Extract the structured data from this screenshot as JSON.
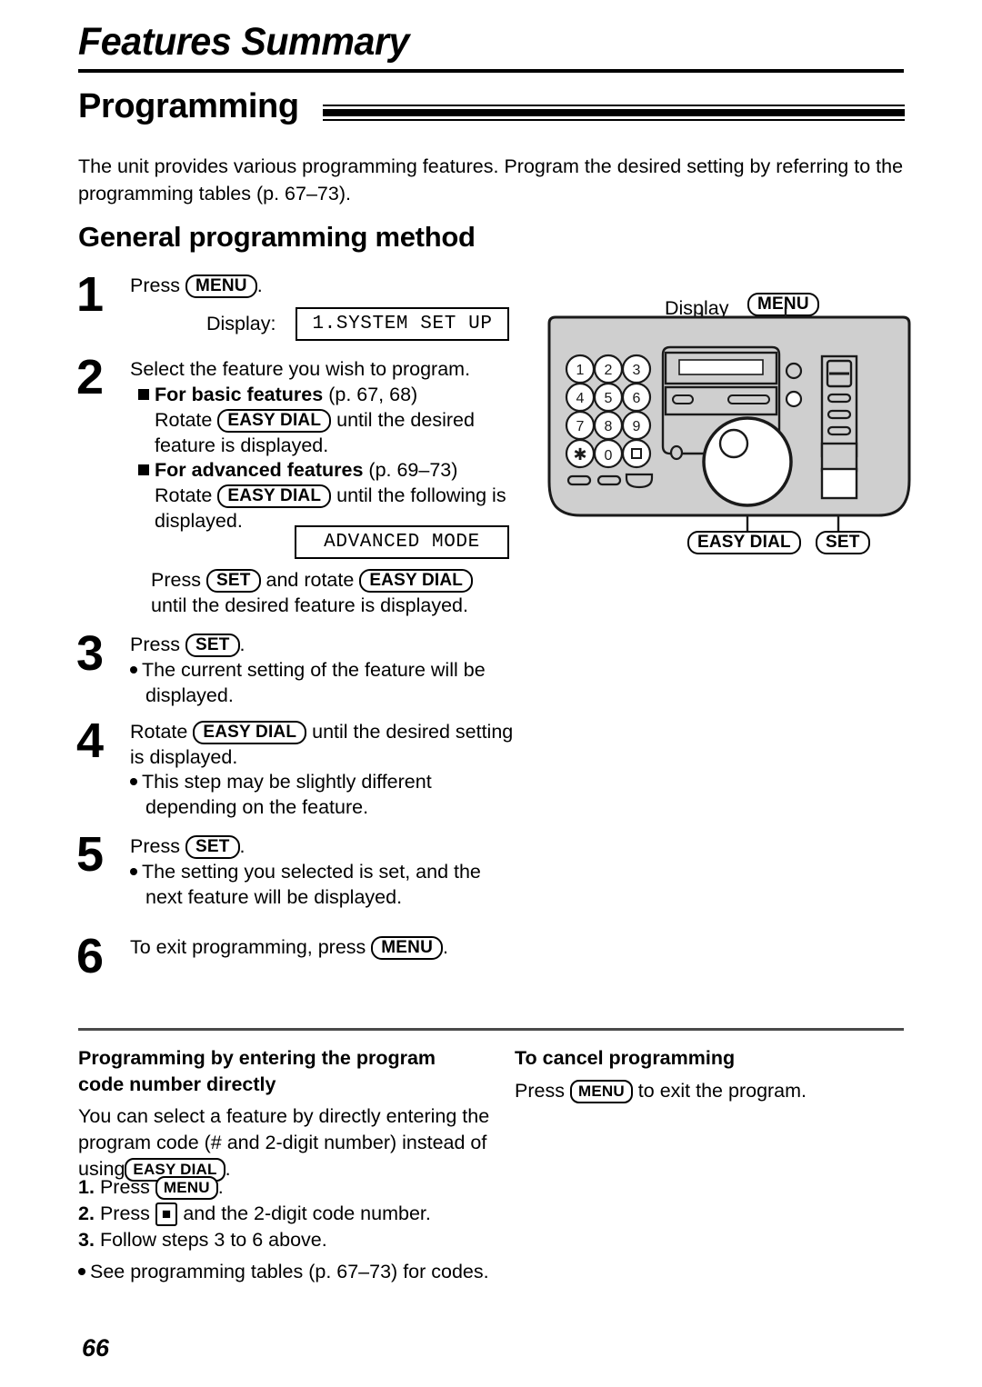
{
  "header": {
    "chapter_title": "Features Summary",
    "section_title": "Programming",
    "intro_line1": "The unit provides various programming features. Program the desired setting by referring to the",
    "intro_line2": "programming tables (p. 67–73).",
    "subsection_title": "General programming method"
  },
  "steps": {
    "s1": {
      "number": "1",
      "press_label": "Press",
      "key_menu": "MENU",
      "period": ".",
      "display_label": "Display:",
      "lcd_text": "1.SYSTEM SET UP"
    },
    "s2": {
      "number": "2",
      "intro": "Select the feature you wish to program.",
      "basic_heading": "For basic features",
      "basic_pages": "(p. 67, 68)",
      "basic_line1_a": "Rotate",
      "basic_key": "EASY DIAL",
      "basic_line1_b": "until the desired",
      "basic_line2": "feature is displayed.",
      "advanced_heading": "For advanced features",
      "advanced_pages": "(p. 69–73)",
      "advanced_line1_a": "Rotate",
      "advanced_key": "EASY DIAL",
      "advanced_line1_b": "until the following is",
      "advanced_line2": "displayed.",
      "lcd_text": "ADVANCED MODE",
      "press_a": "Press",
      "key_set": "SET",
      "press_b": "and rotate",
      "key_easy_dial": "EASY DIAL",
      "press_line2": "until the desired feature is displayed."
    },
    "s3": {
      "number": "3",
      "press_label": "Press",
      "key_set": "SET",
      "period": ".",
      "bullet_line1": "The current setting of the feature will be",
      "bullet_line2": "displayed."
    },
    "s4": {
      "number": "4",
      "line1_a": "Rotate",
      "key_easy_dial": "EASY DIAL",
      "line1_b": "until the desired setting",
      "line2": "is displayed.",
      "bullet_line1": "This step may be slightly different",
      "bullet_line2": "depending on the feature."
    },
    "s5": {
      "number": "5",
      "press_label": "Press",
      "key_set": "SET",
      "period": ".",
      "bullet_line1": "The setting you selected is set, and the",
      "bullet_line2": "next feature will be displayed."
    },
    "s6": {
      "number": "6",
      "text_a": "To exit programming, press",
      "key_menu": "MENU",
      "period": "."
    }
  },
  "device": {
    "label_display": "Display",
    "label_menu": "MENU",
    "label_easy_dial": "EASY DIAL",
    "label_set": "SET",
    "keypad": [
      "1",
      "2",
      "3",
      "4",
      "5",
      "6",
      "7",
      "8",
      "9",
      "✳",
      "0",
      "■"
    ],
    "body_color": "#cfcfcf",
    "outline_color": "#1a1a1a"
  },
  "bottom": {
    "left": {
      "heading_line1": "Programming by entering the program",
      "heading_line2": "code number directly",
      "body_line1": "You can select a feature by directly entering the",
      "body_line2": "program code (# and 2-digit number) instead of",
      "body_line3_a": "using",
      "body_line3_key": "EASY DIAL",
      "body_line3_b": ".",
      "item1_num": "1.",
      "item1_a": "Press",
      "item1_key": "MENU",
      "item1_b": ".",
      "item2_num": "2.",
      "item2_a": "Press",
      "item2_key": "■",
      "item2_b": "and the 2-digit code number.",
      "item3_num": "3.",
      "item3_text": "Follow steps 3 to 6 above.",
      "note": "See programming tables (p. 67–73) for codes."
    },
    "right": {
      "heading": "To cancel programming",
      "body_a": "Press",
      "body_key": "MENU",
      "body_b": "to exit the program."
    }
  },
  "footer": {
    "page_number": "66"
  }
}
